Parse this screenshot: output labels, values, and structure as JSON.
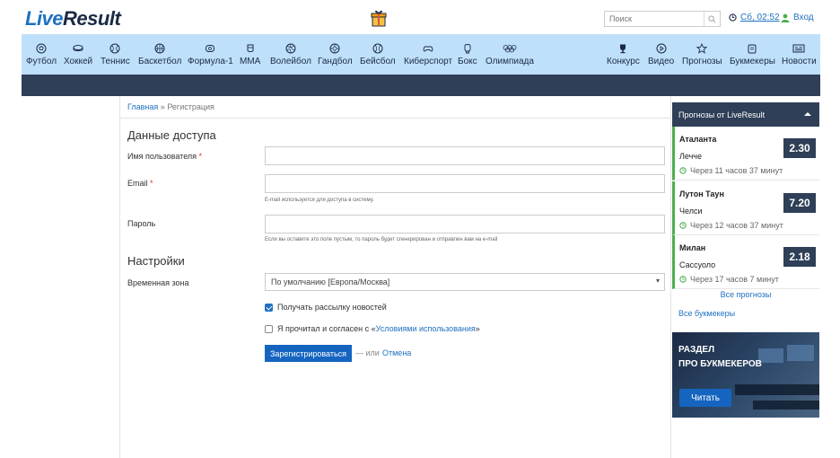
{
  "header": {
    "logo_part1": "Live",
    "logo_part2": "Result",
    "search_placeholder": "Поиск",
    "time": "Сб, 02:52",
    "login": "Вход"
  },
  "sports_nav": [
    {
      "label": "Футбол",
      "icon": "football-icon"
    },
    {
      "label": "Хоккей",
      "icon": "hockey-icon"
    },
    {
      "label": "Теннис",
      "icon": "tennis-icon"
    },
    {
      "label": "Баскетбол",
      "icon": "basketball-icon"
    },
    {
      "label": "Формула-1",
      "icon": "formula1-icon"
    },
    {
      "label": "ММА",
      "icon": "mma-icon"
    },
    {
      "label": "Волейбол",
      "icon": "volleyball-icon"
    },
    {
      "label": "Гандбол",
      "icon": "handball-icon"
    },
    {
      "label": "Бейсбол",
      "icon": "baseball-icon"
    },
    {
      "label": "Киберспорт",
      "icon": "gamepad-icon"
    },
    {
      "label": "Бокс",
      "icon": "boxing-glove-icon"
    },
    {
      "label": "Олимпиада",
      "icon": "olympic-rings-icon"
    }
  ],
  "right_nav": [
    {
      "label": "Конкурс",
      "icon": "trophy-icon"
    },
    {
      "label": "Видео",
      "icon": "play-icon"
    },
    {
      "label": "Прогнозы",
      "icon": "star-icon"
    },
    {
      "label": "Букмекеры",
      "icon": "wallet-icon"
    },
    {
      "label": "Новости",
      "icon": "newspaper-icon"
    }
  ],
  "breadcrumb": {
    "home": "Главная",
    "separator": "»",
    "current": "Регистрация"
  },
  "form": {
    "section_access": "Данные доступа",
    "username_label": "Имя пользователя",
    "email_label": "Email",
    "required_mark": "*",
    "email_hint": "E-mail используется для доступа в систему.",
    "password_label": "Пароль",
    "password_hint": "Если вы оставите это поле пустым, то пароль будет сгенерирован и отправлен вам на e-mail",
    "section_settings": "Настройки",
    "timezone_label": "Временная зона",
    "timezone_value": "По умолчанию [Европа/Москва]",
    "newsletter_label": "Получать рассылку новостей",
    "newsletter_checked": true,
    "terms_prefix": "Я прочитал и согласен с «",
    "terms_link": "Условиями использования",
    "terms_suffix": "»",
    "terms_checked": false,
    "submit_label": "Зарегистрироваться",
    "or_text": "— или",
    "cancel_label": "Отмена"
  },
  "predictions": {
    "header": "Прогнозы от LiveResult",
    "items": [
      {
        "team1": "Аталанта",
        "team2": "Лечче",
        "when": "Через 11 часов 37 минут",
        "odds": "2.30"
      },
      {
        "team1": "Лутон Таун",
        "team2": "Челси",
        "when": "Через 12 часов 37 минут",
        "odds": "7.20"
      },
      {
        "team1": "Милан",
        "team2": "Сассуоло",
        "when": "Через 17 часов 7 минут",
        "odds": "2.18"
      }
    ],
    "all_predictions": "Все прогнозы",
    "all_bookmakers": "Все букмекеры"
  },
  "promo": {
    "line1": "РАЗДЕЛ",
    "line2": "ПРО БУКМЕКЕРОВ",
    "button": "Читать"
  },
  "colors": {
    "brand_blue": "#1f70c1",
    "dark_navy": "#2e3f57",
    "nav_bg": "#bfe0fb",
    "accent_green": "#4caf50"
  }
}
